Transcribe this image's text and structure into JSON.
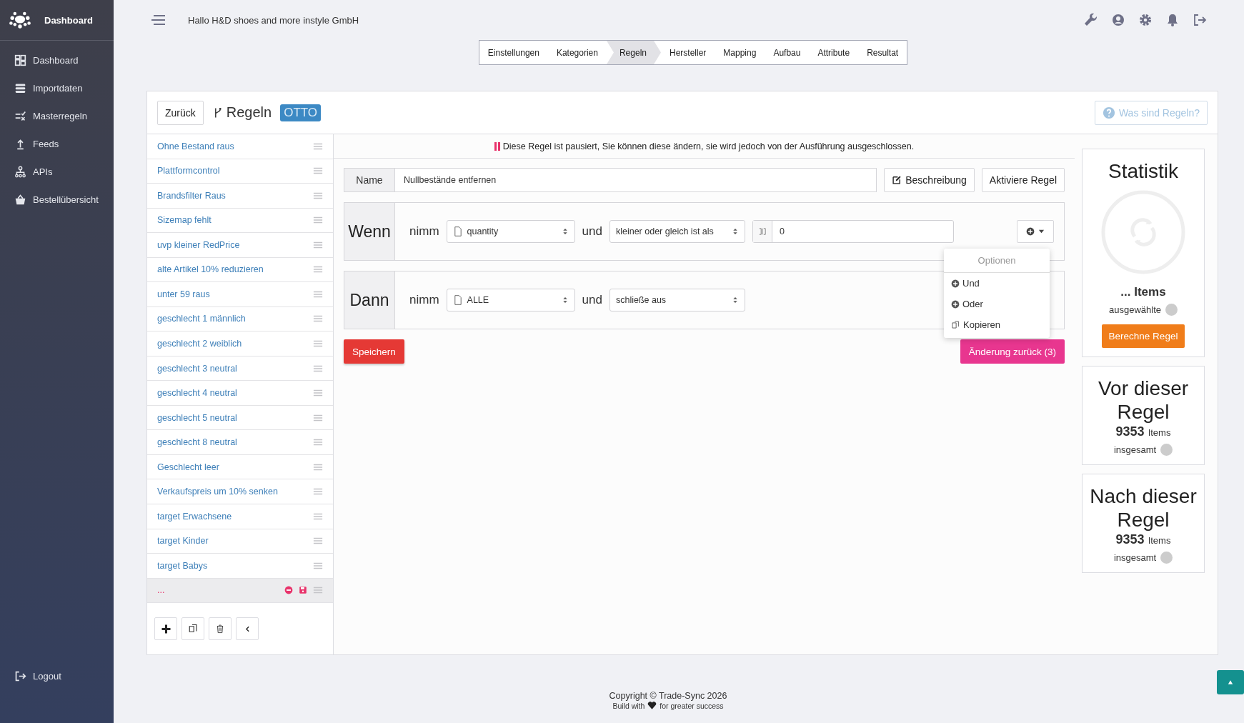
{
  "sidebar": {
    "brand": "Dashboard",
    "items": [
      {
        "label": "Dashboard"
      },
      {
        "label": "Importdaten"
      },
      {
        "label": "Masterregeln"
      },
      {
        "label": "Feeds"
      },
      {
        "label": "APIs"
      },
      {
        "label": "Bestellübersicht"
      }
    ],
    "logout": "Logout"
  },
  "topbar": {
    "greeting": "Hallo H&D shoes and more instyle GmbH"
  },
  "steps": [
    {
      "label": "Einstellungen",
      "selected": false
    },
    {
      "label": "Kategorien",
      "selected": false
    },
    {
      "label": "Regeln",
      "selected": true
    },
    {
      "label": "Hersteller",
      "selected": false
    },
    {
      "label": "Mapping",
      "selected": false
    },
    {
      "label": "Aufbau",
      "selected": false
    },
    {
      "label": "Attribute",
      "selected": false
    },
    {
      "label": "Resultat",
      "selected": false
    }
  ],
  "header": {
    "back": "Zurück",
    "title": "Regeln",
    "badge": "OTTO",
    "help": "Was sind Regeln?"
  },
  "rules": [
    {
      "label": "Ohne Bestand raus",
      "selected": false
    },
    {
      "label": "Plattformcontrol",
      "selected": false
    },
    {
      "label": "Brandsfilter Raus",
      "selected": false
    },
    {
      "label": "Sizemap fehlt",
      "selected": false
    },
    {
      "label": "uvp kleiner RedPrice",
      "selected": false
    },
    {
      "label": "alte Artikel 10% reduzieren",
      "selected": false
    },
    {
      "label": "unter 59 raus",
      "selected": false
    },
    {
      "label": "geschlecht 1 männlich",
      "selected": false
    },
    {
      "label": "geschlecht 2 weiblich",
      "selected": false
    },
    {
      "label": "geschlecht 3 neutral",
      "selected": false
    },
    {
      "label": "geschlecht 4 neutral",
      "selected": false
    },
    {
      "label": "geschlecht 5 neutral",
      "selected": false
    },
    {
      "label": "geschlecht 8 neutral",
      "selected": false
    },
    {
      "label": "Geschlecht leer",
      "selected": false
    },
    {
      "label": "Verkaufspreis um 10% senken",
      "selected": false
    },
    {
      "label": "target Erwachsene",
      "selected": false
    },
    {
      "label": "target Kinder",
      "selected": false
    },
    {
      "label": "target Babys",
      "selected": false
    },
    {
      "label": "...",
      "selected": true
    }
  ],
  "editor": {
    "notice": "Diese Regel ist pausiert, Sie können diese ändern, sie wird jedoch von der Ausführung ausgeschlossen.",
    "name_label": "Name",
    "name_value": "Nullbestände entfernen",
    "describe": "Beschreibung",
    "activate": "Aktiviere Regel",
    "conditions": [
      {
        "title": "Wenn",
        "take": "nimm",
        "field": "quantity",
        "and": "und",
        "operator": "kleiner oder gleich ist als",
        "value": "0"
      },
      {
        "title": "Dann",
        "take": "nimm",
        "field": "ALLE",
        "and": "und",
        "operator": "schließe aus"
      }
    ],
    "save": "Speichern",
    "undo": "Änderung zurück (3)",
    "menu": {
      "header": "Optionen",
      "items": [
        "Und",
        "Oder",
        "Kopieren"
      ]
    }
  },
  "stats": {
    "title": "Statistik",
    "items": "... Items",
    "selected_label": "ausgewählte",
    "compute": "Berechne Regel",
    "cards": [
      {
        "title": "Vor dieser Regel",
        "count": "9353",
        "unit": "Items",
        "caption": "insgesamt"
      },
      {
        "title": "Nach dieser Regel",
        "count": "9353",
        "unit": "Items",
        "caption": "insgesamt"
      }
    ]
  },
  "footer": {
    "copyright": "Copyright © Trade-Sync 2026",
    "build_before": "Build with",
    "build_after": "for greater success"
  }
}
